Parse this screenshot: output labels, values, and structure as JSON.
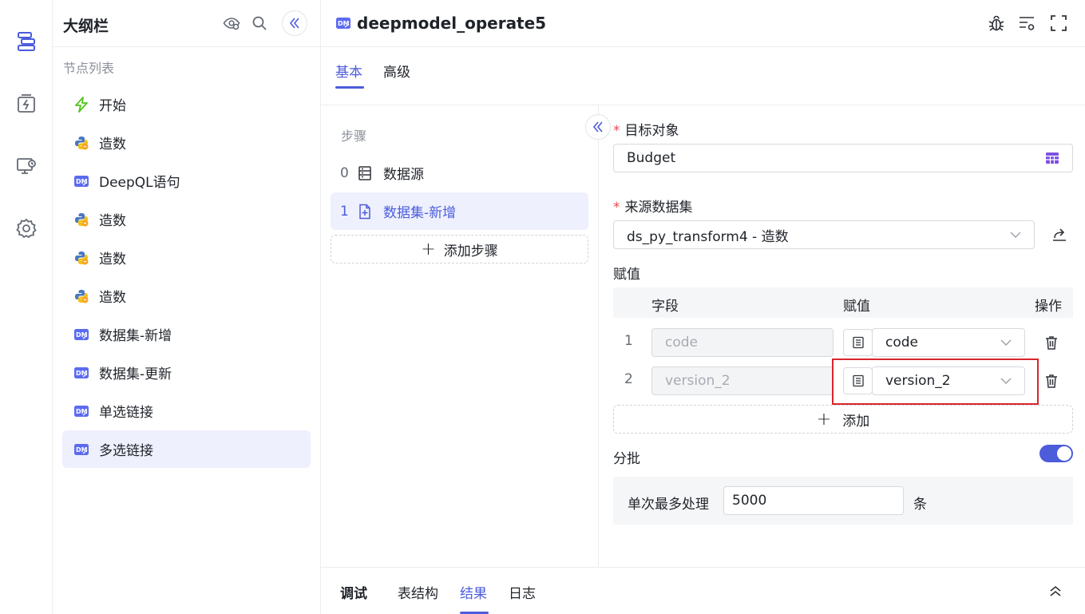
{
  "rail": {
    "items": [
      {
        "icon": "outline-icon",
        "active": true
      },
      {
        "icon": "trigger-box-icon"
      },
      {
        "icon": "monitor-icon"
      },
      {
        "icon": "settings-icon"
      }
    ]
  },
  "outline": {
    "title": "大纲栏",
    "section_label": "节点列表",
    "nodes": [
      {
        "label": "开始",
        "icon": "lightning-icon"
      },
      {
        "label": "造数",
        "icon": "python-icon"
      },
      {
        "label": "DeepQL语句",
        "icon": "dm-icon"
      },
      {
        "label": "造数",
        "icon": "python-icon"
      },
      {
        "label": "造数",
        "icon": "python-icon"
      },
      {
        "label": "造数",
        "icon": "python-icon"
      },
      {
        "label": "数据集-新增",
        "icon": "dm-icon"
      },
      {
        "label": "数据集-更新",
        "icon": "dm-icon"
      },
      {
        "label": "单选链接",
        "icon": "dm-icon"
      },
      {
        "label": "多选链接",
        "icon": "dm-icon",
        "active": true
      }
    ]
  },
  "header": {
    "title": "deepmodel_operate5"
  },
  "tabs": [
    {
      "label": "基本",
      "active": true
    },
    {
      "label": "高级"
    }
  ],
  "steps": {
    "label": "步骤",
    "items": [
      {
        "num": "0",
        "label": "数据源",
        "icon": "datasource-icon"
      },
      {
        "num": "1",
        "label": "数据集-新增",
        "icon": "file-add-icon",
        "active": true
      }
    ],
    "add_label": "添加步骤"
  },
  "form": {
    "target": {
      "label": "目标对象",
      "value": "Budget"
    },
    "source": {
      "label": "来源数据集",
      "value": "ds_py_transform4 - 造数"
    },
    "assign": {
      "label": "赋值",
      "columns": [
        "字段",
        "赋值",
        "操作"
      ],
      "rows": [
        {
          "num": "1",
          "field": "code",
          "value": "code"
        },
        {
          "num": "2",
          "field": "version_2",
          "value": "version_2"
        }
      ],
      "add_label": "添加"
    },
    "batch": {
      "label": "分批",
      "enabled": true,
      "max_label": "单次最多处理",
      "max_value": "5000",
      "unit": "条"
    }
  },
  "bottom_tabs": [
    {
      "label": "调试",
      "bold": true
    },
    {
      "label": "表结构"
    },
    {
      "label": "结果",
      "active": true
    },
    {
      "label": "日志"
    }
  ],
  "colors": {
    "accent": "#4c5cdb",
    "highlight": "#d9262c",
    "required": "#e5484d"
  }
}
